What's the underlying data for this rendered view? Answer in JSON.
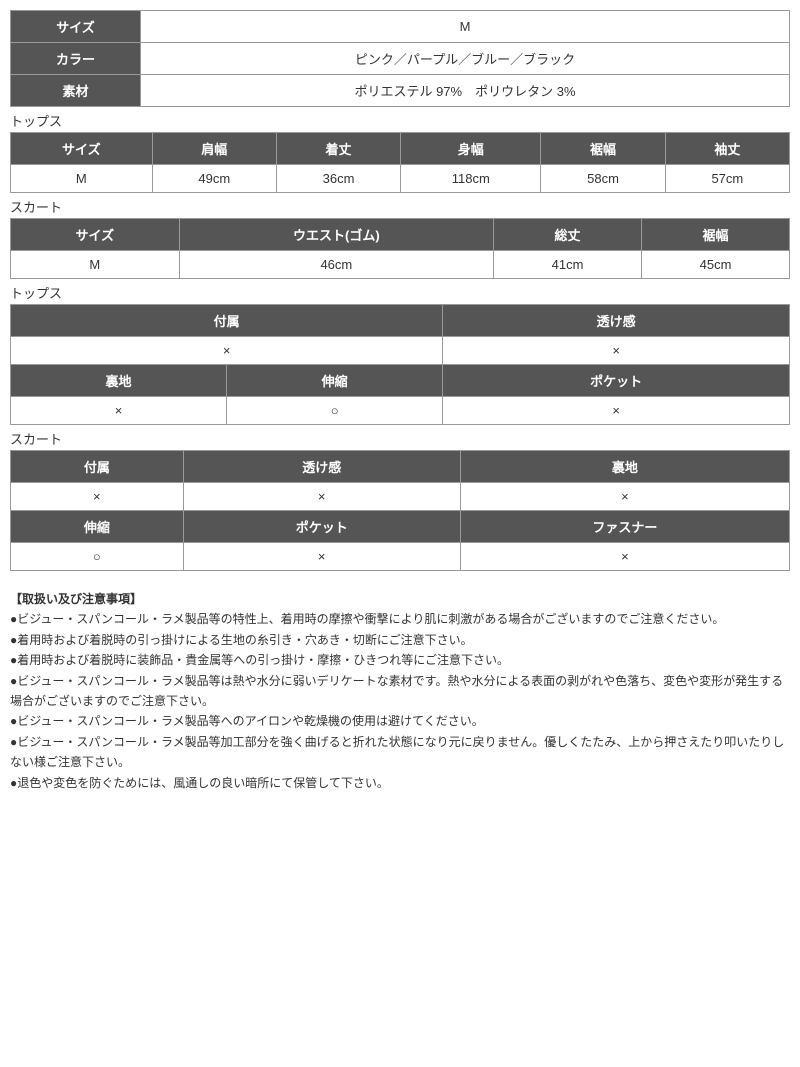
{
  "infoTable": {
    "rows": [
      {
        "label": "サイズ",
        "value": "M"
      },
      {
        "label": "カラー",
        "value": "ピンク／パープル／ブルー／ブラック"
      },
      {
        "label": "素材",
        "value": "ポリエステル 97%　ポリウレタン 3%"
      }
    ]
  },
  "tops": {
    "sectionLabel": "トップス",
    "headers": [
      "サイズ",
      "肩幅",
      "着丈",
      "身幅",
      "裾幅",
      "袖丈"
    ],
    "rows": [
      [
        "M",
        "49cm",
        "36cm",
        "118cm",
        "58cm",
        "57cm"
      ]
    ]
  },
  "skirt": {
    "sectionLabel": "スカート",
    "headers": [
      "サイズ",
      "ウエスト(ゴム)",
      "総丈",
      "裾幅"
    ],
    "rows": [
      [
        "M",
        "46cm",
        "41cm",
        "45cm"
      ]
    ]
  },
  "topsFeature": {
    "sectionLabel": "トップス",
    "row1Headers": [
      "付属",
      "透け感"
    ],
    "row1Values": [
      "×",
      "×"
    ],
    "row2Headers": [
      "裏地",
      "伸縮",
      "ポケット"
    ],
    "row2Values": [
      "×",
      "○",
      "×"
    ]
  },
  "skirtFeature": {
    "sectionLabel": "スカート",
    "row1Headers": [
      "付属",
      "透け感",
      "裏地"
    ],
    "row1Values": [
      "×",
      "×",
      "×"
    ],
    "row2Headers": [
      "伸縮",
      "ポケット",
      "ファスナー"
    ],
    "row2Values": [
      "○",
      "×",
      "×"
    ]
  },
  "notes": {
    "title": "【取扱い及び注意事項】",
    "bullets": [
      "●ビジュー・スパンコール・ラメ製品等の特性上、着用時の摩擦や衝撃により肌に刺激がある場合がございますのでご注意ください。",
      "●着用時および着脱時の引っ掛けによる生地の糸引き・穴あき・切断にご注意下さい。",
      "●着用時および着脱時に装飾品・貴金属等への引っ掛け・摩擦・ひきつれ等にご注意下さい。",
      "●ビジュー・スパンコール・ラメ製品等は熱や水分に弱いデリケートな素材です。熱や水分による表面の剥がれや色落ち、変色や変形が発生する場合がございますのでご注意下さい。",
      "●ビジュー・スパンコール・ラメ製品等へのアイロンや乾燥機の使用は避けてください。",
      "●ビジュー・スパンコール・ラメ製品等加工部分を強く曲げると折れた状態になり元に戻りません。優しくたたみ、上から押さえたり叩いたりしない様ご注意下さい。",
      "●退色や変色を防ぐためには、風通しの良い暗所にて保管して下さい。"
    ]
  }
}
